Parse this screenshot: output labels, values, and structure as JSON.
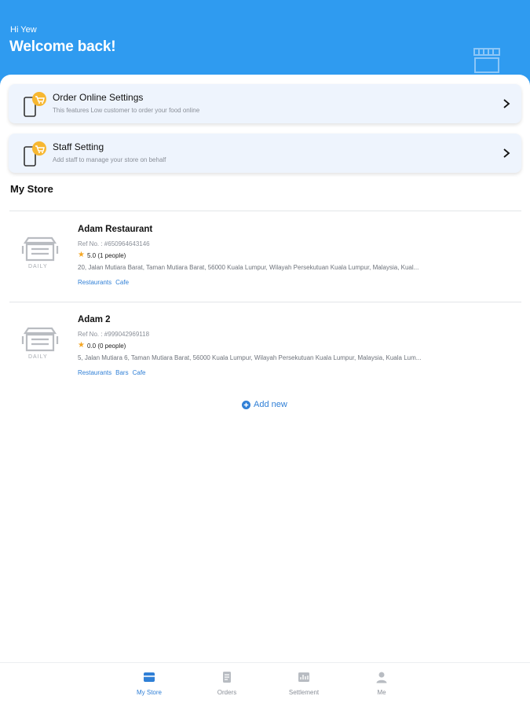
{
  "header": {
    "greeting": "Hi Yew",
    "title": "Welcome back!"
  },
  "settings_cards": [
    {
      "title": "Order Online Settings",
      "subtitle": "This features Low customer to order your food online"
    },
    {
      "title": "Staff Setting",
      "subtitle": "Add staff to manage your store on behalf"
    }
  ],
  "my_store": {
    "section_title": "My Store",
    "stores": [
      {
        "logo_text": "DAILY",
        "name": "Adam Restaurant",
        "ref": "Ref No. : #6509646431​46",
        "rating": "5.0 (1 people)",
        "address": "20, Jalan Mutiara Barat, Taman Mutiara Barat, 56000 Kuala Lumpur, Wilayah Persekutuan Kuala Lumpur, Malaysia, Kual...",
        "tags": [
          "Restaurants",
          "Cafe"
        ]
      },
      {
        "logo_text": "DAILY",
        "name": "Adam 2",
        "ref": "Ref No. : #9990429​69118",
        "rating": "0.0 (0 people)",
        "address": "5, Jalan Mutiara 6, Taman Mutiara Barat, 56000 Kuala Lumpur, Wilayah Persekutuan Kuala Lumpur, Malaysia, Kuala Lum...",
        "tags": [
          "Restaurants",
          "Bars",
          "Cafe"
        ]
      }
    ],
    "add_new_label": "Add new"
  },
  "tabbar": {
    "items": [
      {
        "label": "My Store",
        "icon": "store-icon",
        "active": true
      },
      {
        "label": "Orders",
        "icon": "orders-icon",
        "active": false
      },
      {
        "label": "Settlement",
        "icon": "settlement-icon",
        "active": false
      },
      {
        "label": "Me",
        "icon": "person-icon",
        "active": false
      }
    ]
  },
  "colors": {
    "header_bg": "#2f9bf0",
    "accent": "#2f7fd6",
    "card_bg": "#eef4fd",
    "star": "#f5a623"
  }
}
